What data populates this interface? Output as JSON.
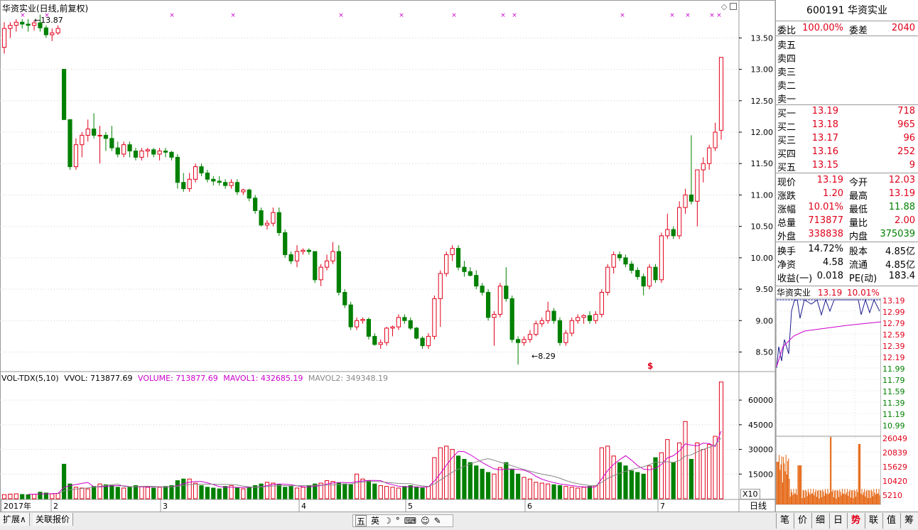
{
  "title": "华资实业(日线,前复权)",
  "stock_header": "600191 华资实业",
  "vol_indicator": {
    "name": "VOL-TDX(5,10)",
    "vvol": "VVOL: 713877.69",
    "volume": "VOLUME: 713877.69",
    "mavol1": "MAVOL1: 432685.19",
    "mavol2": "MAVOL2: 349348.19"
  },
  "price_axis": [
    "13.50",
    "13.00",
    "12.50",
    "12.00",
    "11.50",
    "11.00",
    "10.50",
    "10.00",
    "9.50",
    "9.00",
    "8.50"
  ],
  "volume_axis": [
    "60000",
    "45000",
    "30000",
    "15000"
  ],
  "x_axis": [
    "2017年",
    "2",
    "3",
    "4",
    "5",
    "6",
    "7"
  ],
  "annotations": {
    "high": "13.87",
    "low": "8.29",
    "cursor_mark": "$"
  },
  "x10_label": "X10",
  "bottom_tabs": [
    "扩展∧",
    "关联报价"
  ],
  "center_tools": [
    "五",
    "英"
  ],
  "period_label": "日线",
  "right_tabs": [
    "笔",
    "价",
    "细",
    "日",
    "势",
    "联",
    "值",
    "筹"
  ],
  "quote_panel": {
    "weibi": {
      "label": "委比",
      "value": "100.00%",
      "label2": "委差",
      "value2": "2040"
    },
    "sell": [
      {
        "label": "卖五"
      },
      {
        "label": "卖四"
      },
      {
        "label": "卖三"
      },
      {
        "label": "卖二"
      },
      {
        "label": "卖一"
      }
    ],
    "buy": [
      {
        "label": "买一",
        "price": "13.19",
        "vol": "718"
      },
      {
        "label": "买二",
        "price": "13.18",
        "vol": "965"
      },
      {
        "label": "买三",
        "price": "13.17",
        "vol": "96"
      },
      {
        "label": "买四",
        "price": "13.16",
        "vol": "252"
      },
      {
        "label": "买五",
        "price": "13.15",
        "vol": "9"
      }
    ],
    "stats": [
      {
        "l1": "现价",
        "v1": "13.19",
        "l2": "今开",
        "v2": "12.03"
      },
      {
        "l1": "涨跌",
        "v1": "1.20",
        "l2": "最高",
        "v2": "13.19"
      },
      {
        "l1": "涨幅",
        "v1": "10.01%",
        "l2": "最低",
        "v2": "11.88"
      },
      {
        "l1": "总量",
        "v1": "713877",
        "l2": "量比",
        "v2": "2.00"
      },
      {
        "l1": "外盘",
        "v1": "338838",
        "l2": "内盘",
        "v2": "375039"
      }
    ],
    "fin": [
      {
        "l1": "换手",
        "v1": "14.72%",
        "l2": "股本",
        "v2": "4.85亿"
      },
      {
        "l1": "净资",
        "v1": "4.58",
        "l2": "流通",
        "v2": "4.85亿"
      },
      {
        "l1": "收益(一)",
        "v1": "0.018",
        "l2": "PE(动)",
        "v2": "183.4"
      }
    ]
  },
  "mini_chart": {
    "title": "华资实业",
    "price": "13.19",
    "pct": "10.01%",
    "price_ticks": [
      "13.19",
      "12.99",
      "12.79",
      "12.59",
      "12.39",
      "12.19",
      "11.99",
      "11.79",
      "11.59",
      "11.39",
      "11.19",
      "10.99"
    ],
    "vol_ticks": [
      "26049",
      "20839",
      "15629",
      "10420",
      "5210"
    ]
  },
  "colors": {
    "up": "#e0001a",
    "down": "#008000",
    "bg": "#ffffff",
    "grid": "#cfcfcf",
    "ma1": "#cc00cc",
    "ma2": "#888888"
  },
  "chart_data": {
    "type": "candlestick",
    "ylim": [
      8.2,
      13.9
    ],
    "vol_ylim": [
      0,
      70000
    ],
    "candles": [
      [
        13.35,
        13.75,
        13.25,
        13.65
      ],
      [
        13.65,
        13.75,
        13.5,
        13.7
      ],
      [
        13.7,
        13.8,
        13.6,
        13.75
      ],
      [
        13.75,
        13.8,
        13.65,
        13.72
      ],
      [
        13.72,
        13.8,
        13.6,
        13.7
      ],
      [
        13.7,
        13.78,
        13.62,
        13.74
      ],
      [
        13.74,
        13.87,
        13.6,
        13.66
      ],
      [
        13.66,
        13.7,
        13.5,
        13.55
      ],
      [
        13.55,
        13.65,
        13.45,
        13.58
      ],
      [
        13.58,
        13.7,
        13.55,
        13.65
      ],
      [
        13.0,
        13.0,
        12.2,
        12.2
      ],
      [
        12.2,
        12.0,
        11.4,
        11.45
      ],
      [
        11.45,
        11.9,
        11.4,
        11.8
      ],
      [
        11.8,
        12.0,
        11.6,
        11.95
      ],
      [
        11.95,
        12.2,
        11.85,
        12.05
      ],
      [
        12.05,
        12.3,
        11.9,
        11.95
      ],
      [
        11.95,
        12.1,
        11.5,
        11.95
      ],
      [
        11.95,
        12.0,
        11.7,
        11.9
      ],
      [
        11.9,
        12.1,
        11.7,
        11.75
      ],
      [
        11.75,
        11.85,
        11.6,
        11.65
      ],
      [
        11.65,
        11.85,
        11.6,
        11.8
      ],
      [
        11.8,
        11.85,
        11.6,
        11.7
      ],
      [
        11.7,
        11.75,
        11.55,
        11.6
      ],
      [
        11.6,
        11.75,
        11.55,
        11.7
      ],
      [
        11.7,
        11.75,
        11.6,
        11.72
      ],
      [
        11.72,
        11.75,
        11.6,
        11.65
      ],
      [
        11.65,
        11.75,
        11.55,
        11.7
      ],
      [
        11.7,
        11.75,
        11.6,
        11.68
      ],
      [
        11.68,
        11.7,
        11.55,
        11.6
      ],
      [
        11.6,
        11.65,
        11.1,
        11.2
      ],
      [
        11.2,
        11.35,
        11.05,
        11.1
      ],
      [
        11.1,
        11.35,
        11.05,
        11.25
      ],
      [
        11.25,
        11.5,
        11.2,
        11.45
      ],
      [
        11.45,
        11.5,
        11.3,
        11.35
      ],
      [
        11.35,
        11.4,
        11.2,
        11.25
      ],
      [
        11.25,
        11.3,
        11.15,
        11.22
      ],
      [
        11.22,
        11.3,
        11.15,
        11.2
      ],
      [
        11.2,
        11.25,
        11.1,
        11.15
      ],
      [
        11.15,
        11.25,
        11.1,
        11.2
      ],
      [
        11.2,
        11.25,
        11.0,
        11.05
      ],
      [
        11.05,
        11.1,
        11.0,
        11.08
      ],
      [
        11.08,
        11.1,
        10.9,
        10.95
      ],
      [
        10.95,
        11.0,
        10.7,
        10.75
      ],
      [
        10.75,
        10.8,
        10.5,
        10.52
      ],
      [
        10.52,
        10.6,
        10.45,
        10.55
      ],
      [
        10.55,
        10.8,
        10.5,
        10.72
      ],
      [
        10.72,
        10.8,
        10.35,
        10.4
      ],
      [
        10.4,
        10.45,
        10.0,
        10.05
      ],
      [
        10.05,
        10.1,
        9.9,
        9.95
      ],
      [
        9.95,
        10.2,
        9.85,
        10.1
      ],
      [
        10.1,
        10.15,
        10.05,
        10.12
      ],
      [
        10.12,
        10.15,
        10.05,
        10.1
      ],
      [
        10.1,
        10.1,
        9.6,
        9.65
      ],
      [
        9.65,
        9.9,
        9.55,
        9.85
      ],
      [
        9.85,
        10.05,
        9.8,
        9.95
      ],
      [
        9.95,
        10.25,
        9.9,
        10.1
      ],
      [
        10.1,
        10.2,
        9.4,
        9.45
      ],
      [
        9.45,
        9.5,
        9.2,
        9.25
      ],
      [
        9.25,
        9.3,
        8.85,
        8.9
      ],
      [
        8.9,
        9.05,
        8.85,
        9.0
      ],
      [
        9.0,
        9.05,
        8.95,
        9.02
      ],
      [
        9.02,
        9.05,
        8.7,
        8.75
      ],
      [
        8.75,
        8.8,
        8.6,
        8.62
      ],
      [
        8.62,
        8.7,
        8.55,
        8.65
      ],
      [
        8.65,
        8.9,
        8.6,
        8.88
      ],
      [
        8.88,
        8.92,
        8.75,
        8.9
      ],
      [
        8.9,
        9.1,
        8.85,
        9.05
      ],
      [
        9.05,
        9.1,
        8.95,
        9.0
      ],
      [
        9.0,
        9.05,
        8.85,
        8.88
      ],
      [
        8.88,
        8.9,
        8.7,
        8.72
      ],
      [
        8.72,
        8.75,
        8.55,
        8.6
      ],
      [
        8.6,
        8.8,
        8.55,
        8.75
      ],
      [
        8.75,
        9.4,
        8.7,
        9.35
      ],
      [
        9.35,
        9.8,
        8.9,
        9.75
      ],
      [
        9.75,
        10.1,
        9.7,
        10.05
      ],
      [
        10.05,
        10.2,
        9.95,
        10.15
      ],
      [
        10.15,
        10.2,
        9.8,
        9.85
      ],
      [
        9.85,
        9.95,
        9.7,
        9.78
      ],
      [
        9.78,
        9.85,
        9.7,
        9.72
      ],
      [
        9.72,
        9.8,
        9.5,
        9.55
      ],
      [
        9.55,
        9.6,
        9.4,
        9.45
      ],
      [
        9.45,
        9.5,
        9.0,
        9.05
      ],
      [
        9.05,
        9.15,
        8.6,
        9.1
      ],
      [
        9.1,
        9.6,
        9.05,
        9.55
      ],
      [
        9.55,
        9.85,
        9.3,
        9.35
      ],
      [
        9.35,
        9.4,
        8.65,
        8.7
      ],
      [
        8.7,
        8.75,
        8.3,
        8.65
      ],
      [
        8.65,
        8.75,
        8.6,
        8.7
      ],
      [
        8.7,
        8.85,
        8.65,
        8.78
      ],
      [
        8.78,
        9.0,
        8.75,
        8.95
      ],
      [
        8.95,
        9.05,
        8.9,
        9.0
      ],
      [
        9.0,
        9.3,
        8.95,
        9.15
      ],
      [
        9.15,
        9.2,
        8.95,
        9.0
      ],
      [
        9.0,
        9.05,
        8.6,
        8.65
      ],
      [
        8.65,
        8.85,
        8.6,
        8.8
      ],
      [
        8.8,
        9.05,
        8.75,
        9.0
      ],
      [
        9.0,
        9.1,
        8.95,
        9.05
      ],
      [
        9.05,
        9.1,
        8.95,
        9.08
      ],
      [
        9.08,
        9.15,
        8.95,
        9.0
      ],
      [
        9.0,
        9.15,
        8.95,
        9.1
      ],
      [
        9.1,
        9.5,
        9.05,
        9.45
      ],
      [
        9.45,
        9.9,
        9.4,
        9.85
      ],
      [
        9.85,
        10.1,
        9.75,
        10.05
      ],
      [
        10.05,
        10.1,
        9.95,
        10.0
      ],
      [
        10.0,
        10.05,
        9.85,
        9.9
      ],
      [
        9.9,
        9.95,
        9.75,
        9.8
      ],
      [
        9.8,
        9.85,
        9.65,
        9.7
      ],
      [
        9.7,
        9.75,
        9.4,
        9.55
      ],
      [
        9.55,
        9.9,
        9.5,
        9.85
      ],
      [
        9.85,
        9.9,
        9.6,
        9.65
      ],
      [
        9.65,
        10.4,
        9.6,
        10.35
      ],
      [
        10.35,
        10.7,
        10.3,
        10.45
      ],
      [
        10.45,
        10.5,
        10.3,
        10.35
      ],
      [
        10.35,
        10.9,
        10.3,
        10.8
      ],
      [
        10.8,
        11.1,
        10.7,
        11.0
      ],
      [
        11.0,
        11.95,
        10.85,
        10.9
      ],
      [
        10.9,
        11.3,
        10.5,
        11.4
      ],
      [
        11.4,
        11.6,
        11.2,
        11.5
      ],
      [
        11.5,
        11.8,
        11.4,
        11.75
      ],
      [
        11.75,
        12.15,
        11.7,
        12.0
      ],
      [
        12.03,
        13.19,
        11.88,
        13.19
      ]
    ],
    "volumes": [
      2500,
      2800,
      3000,
      2600,
      2400,
      2700,
      4000,
      3500,
      3000,
      3200,
      21000,
      9000,
      7000,
      6500,
      6000,
      7500,
      9000,
      8500,
      8000,
      7000,
      6500,
      7000,
      8000,
      7500,
      7000,
      6500,
      7000,
      7500,
      8000,
      11000,
      12000,
      12000,
      9500,
      8000,
      7000,
      6500,
      6000,
      7500,
      8000,
      6500,
      6000,
      7000,
      8000,
      9000,
      10000,
      9500,
      8500,
      7000,
      7500,
      6500,
      7000,
      8000,
      9000,
      9500,
      11000,
      10500,
      9500,
      9000,
      8500,
      15000,
      12000,
      11000,
      9000,
      8000,
      7500,
      7000,
      6500,
      7500,
      8000,
      7000,
      6500,
      7500,
      25000,
      31000,
      32000,
      30000,
      26000,
      24000,
      22000,
      20000,
      18000,
      16000,
      15000,
      19000,
      22000,
      18000,
      15000,
      13000,
      12000,
      10000,
      9500,
      9000,
      8500,
      8000,
      7500,
      7000,
      6500,
      7000,
      7500,
      8000,
      31000,
      32000,
      26000,
      22000,
      20000,
      17000,
      16000,
      15000,
      20000,
      25000,
      28000,
      36000,
      22000,
      34000,
      47000,
      24000,
      34000,
      30000,
      33000,
      38000,
      71000
    ]
  }
}
